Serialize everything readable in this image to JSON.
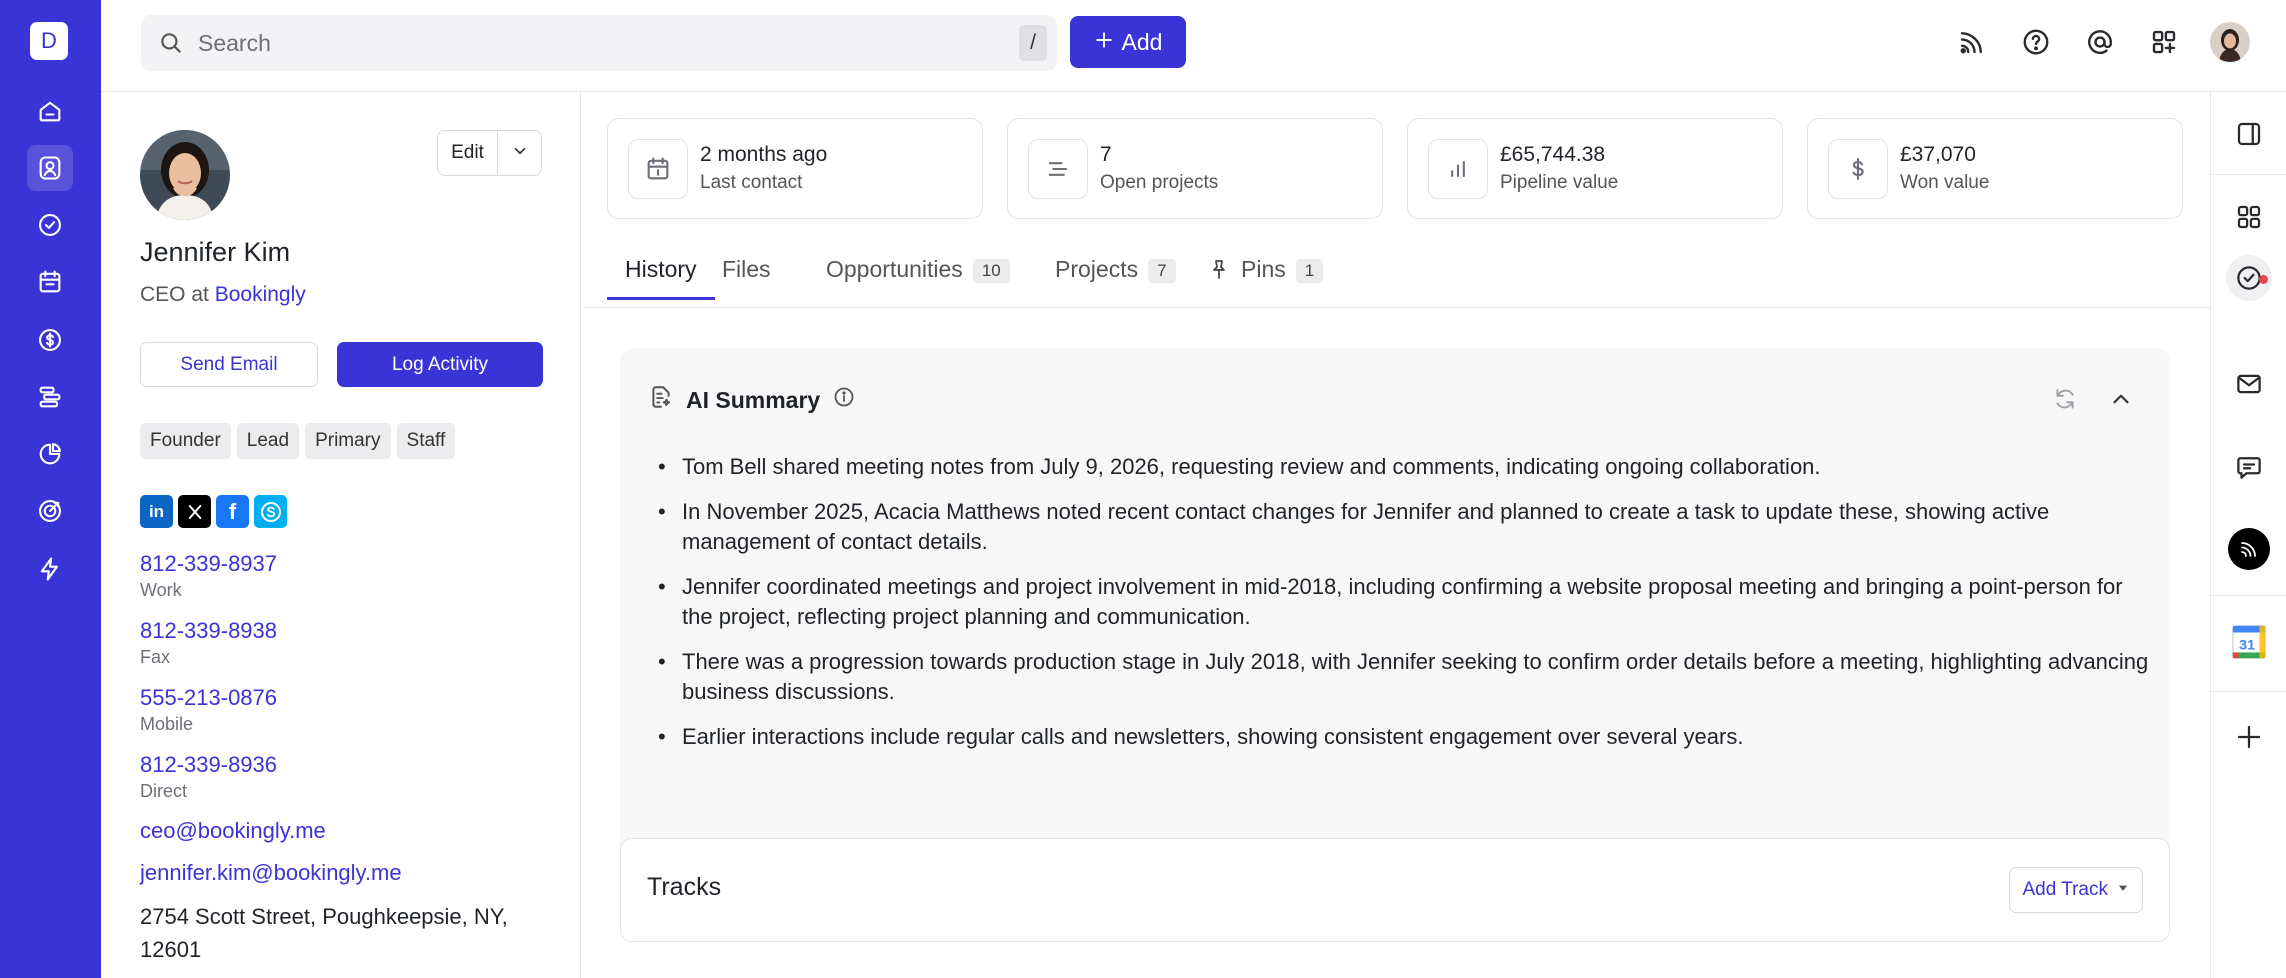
{
  "app": {
    "logo_letter": "D"
  },
  "leftnav": {
    "items": [
      {
        "name": "home-icon"
      },
      {
        "name": "contacts-icon"
      },
      {
        "name": "tasks-icon"
      },
      {
        "name": "calendar-icon"
      },
      {
        "name": "deals-icon"
      },
      {
        "name": "projects-icon"
      },
      {
        "name": "reports-icon"
      },
      {
        "name": "goals-icon"
      },
      {
        "name": "automations-icon"
      }
    ],
    "active": "contacts-icon"
  },
  "search": {
    "placeholder": "Search",
    "shortcut": "/"
  },
  "toolbar": {
    "add_label": "Add"
  },
  "contact": {
    "name": "Jennifer Kim",
    "role_prefix": "CEO at",
    "company": "Bookingly",
    "edit_label": "Edit",
    "send_email_label": "Send Email",
    "log_activity_label": "Log Activity",
    "tags": [
      "Founder",
      "Lead",
      "Primary",
      "Staff"
    ],
    "socials": [
      "linkedin-icon",
      "x-icon",
      "facebook-icon",
      "skype-icon"
    ],
    "phones": [
      {
        "number": "812-339-8937",
        "label": "Work"
      },
      {
        "number": "812-339-8938",
        "label": "Fax"
      },
      {
        "number": "555-213-0876",
        "label": "Mobile"
      },
      {
        "number": "812-339-8936",
        "label": "Direct"
      }
    ],
    "emails": [
      "ceo@bookingly.me",
      "jennifer.kim@bookingly.me"
    ],
    "address": "2754 Scott Street, Poughkeepsie, NY, 12601"
  },
  "stats": [
    {
      "value": "2 months ago",
      "label": "Last contact",
      "icon": "calendar-icon"
    },
    {
      "value": "7",
      "label": "Open projects",
      "icon": "list-icon"
    },
    {
      "value": "£65,744.38",
      "label": "Pipeline value",
      "icon": "bar-chart-icon"
    },
    {
      "value": "£37,070",
      "label": "Won value",
      "icon": "dollar-icon"
    }
  ],
  "tabs": [
    {
      "label": "History",
      "active": true
    },
    {
      "label": "Files"
    },
    {
      "label": "Opportunities",
      "count": "10"
    },
    {
      "label": "Projects",
      "count": "7"
    },
    {
      "label": "Pins",
      "count": "1"
    }
  ],
  "ai_summary": {
    "title": "AI Summary",
    "points": [
      "Tom Bell shared meeting notes from July 9, 2026, requesting review and comments, indicating ongoing collaboration.",
      "In November 2025, Acacia Matthews noted recent contact changes for Jennifer and planned to create a task to update these, showing active management of contact details.",
      "Jennifer coordinated meetings and project involvement in mid-2018, including confirming a website proposal meeting and bringing a point-person for the project, reflecting project planning and communication.",
      "There was a progression towards production stage in July 2018, with Jennifer seeking to confirm order details before a meeting, highlighting advancing business discussions.",
      "Earlier interactions include regular calls and newsletters, showing consistent engagement over several years."
    ]
  },
  "tracks": {
    "title": "Tracks",
    "add_label": "Add Track"
  },
  "rightrail": {
    "calendar_day": "31",
    "items": [
      "panel-icon",
      "apps-icon",
      "tasks-icon",
      "mail-icon",
      "chat-icon",
      "feed-icon",
      "google-calendar-icon",
      "plus-icon"
    ]
  },
  "colors": {
    "accent": "#3a33d6",
    "notification": "#e5484d"
  }
}
